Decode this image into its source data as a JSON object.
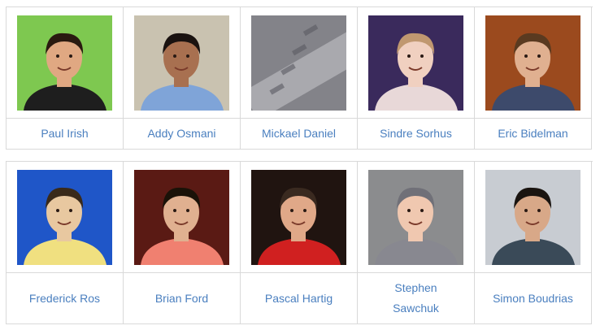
{
  "rows": [
    {
      "people": [
        {
          "name": "Paul Irish",
          "avatar_icon": "person-photo",
          "bg": "#7ec850",
          "accent": "#1e1e1e",
          "skin": "#e0a882",
          "hair": "#2a1a10"
        },
        {
          "name": "Addy Osmani",
          "avatar_icon": "person-photo",
          "bg": "#c9c2b0",
          "accent": "#7fa4d8",
          "skin": "#a87050",
          "hair": "#1a1210"
        },
        {
          "name": "Mickael Daniel",
          "avatar_icon": "text-photo",
          "bg": "#6d6d72",
          "accent": "#9a9aa0",
          "skin": "#c8c8cc",
          "hair": "#5a5a60"
        },
        {
          "name": "Sindre Sorhus",
          "avatar_icon": "person-photo",
          "bg": "#3a2a5c",
          "accent": "#e8d8d8",
          "skin": "#f0d0c0",
          "hair": "#c09870"
        },
        {
          "name": "Eric Bidelman",
          "avatar_icon": "person-photo",
          "bg": "#9b4a1e",
          "accent": "#3d4a6b",
          "skin": "#e0b090",
          "hair": "#5a3a20"
        }
      ]
    },
    {
      "people": [
        {
          "name": "Frederick Ros",
          "avatar_icon": "person-photo",
          "bg": "#1f56c8",
          "accent": "#f0e080",
          "skin": "#e8c8a0",
          "hair": "#3a2a1a"
        },
        {
          "name": "Brian Ford",
          "avatar_icon": "person-photo",
          "bg": "#5a1a14",
          "accent": "#f08070",
          "skin": "#e0b090",
          "hair": "#1a1208"
        },
        {
          "name": "Pascal Hartig",
          "avatar_icon": "person-photo",
          "bg": "#201410",
          "accent": "#d02020",
          "skin": "#e0a888",
          "hair": "#3a2a20"
        },
        {
          "name": "Stephen Sawchuk",
          "avatar_icon": "person-photo",
          "bg": "#8b8c8e",
          "accent": "#888890",
          "skin": "#f0c8b0",
          "hair": "#707078"
        },
        {
          "name": "Simon Boudrias",
          "avatar_icon": "person-photo",
          "bg": "#c8ccd2",
          "accent": "#3a4a58",
          "skin": "#d8a888",
          "hair": "#1a1410"
        }
      ]
    }
  ]
}
